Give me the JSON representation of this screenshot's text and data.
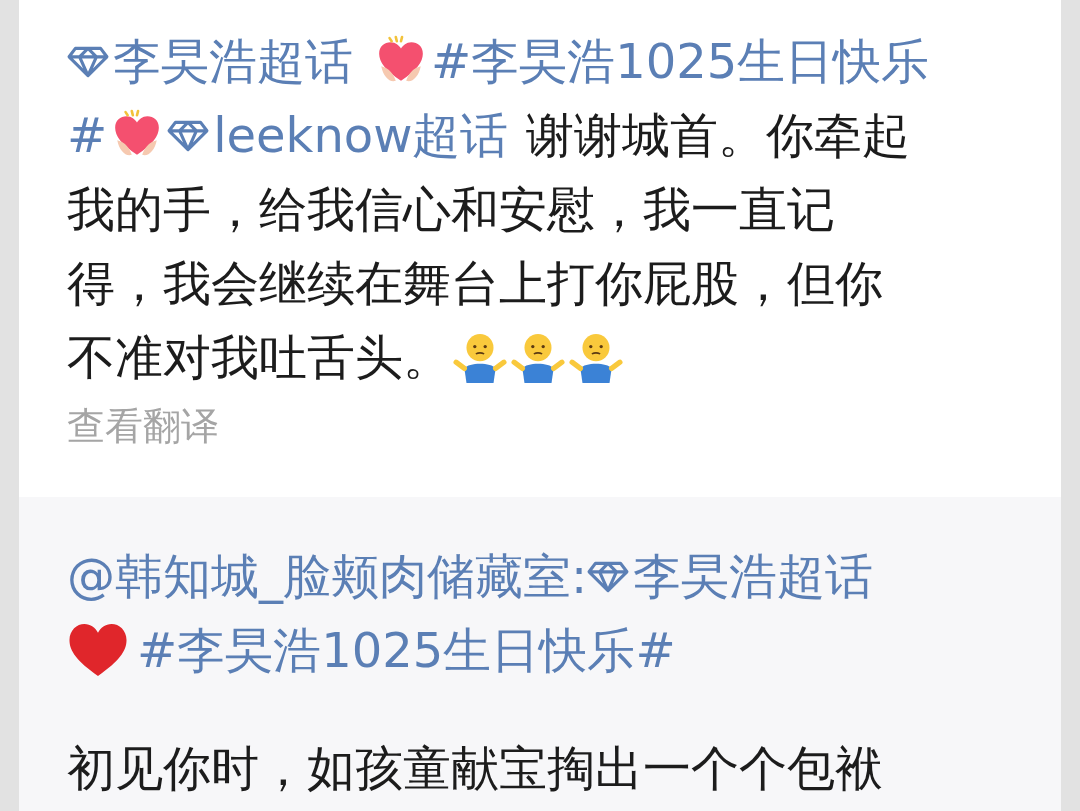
{
  "post": {
    "lines": [
      [
        {
          "kind": "supertopic",
          "text": "李旲浩超话"
        },
        {
          "kind": "sparkle-heart"
        },
        {
          "kind": "hashtag",
          "text": "#李旲浩1025生日快乐"
        }
      ],
      [
        {
          "kind": "hashtag",
          "text": "#"
        },
        {
          "kind": "sparkle-heart"
        },
        {
          "kind": "supertopic",
          "text": "leeknow超话"
        },
        {
          "kind": "text",
          "text": "谢谢城首。你牵起"
        }
      ],
      [
        {
          "kind": "text",
          "text": "我的手，给我信心和安慰，我一直记"
        }
      ],
      [
        {
          "kind": "text",
          "text": "得，我会继续在舞台上打你屁股，但你"
        }
      ],
      [
        {
          "kind": "text",
          "text": "不准对我吐舌头。"
        },
        {
          "kind": "shrug"
        },
        {
          "kind": "shrug"
        },
        {
          "kind": "shrug"
        }
      ]
    ],
    "translate_link": "查看翻译"
  },
  "repost": {
    "lines": [
      [
        {
          "kind": "mention",
          "text": "@韩知城_脸颊肉储藏室:"
        },
        {
          "kind": "supertopic",
          "text": "李旲浩超话"
        }
      ],
      [
        {
          "kind": "red-heart"
        },
        {
          "kind": "hashtag",
          "text": "#李旲浩1025生日快乐#"
        }
      ]
    ],
    "body": "初见你时，如孩童献宝掏出一个个包袱"
  }
}
